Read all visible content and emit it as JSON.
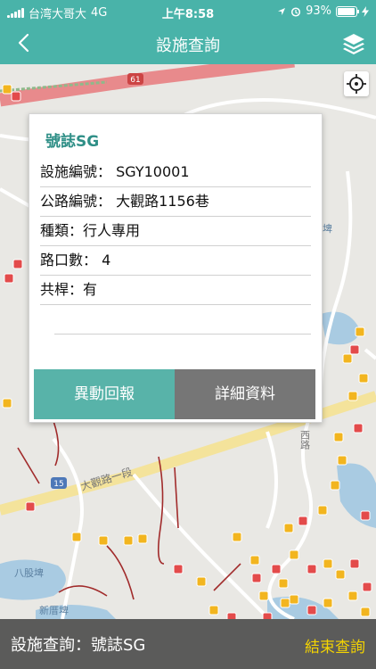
{
  "status_bar": {
    "carrier": "台湾大哥大",
    "network": "4G",
    "time": "上午8:58",
    "battery_percent": "93%",
    "battery_level": 0.93
  },
  "nav": {
    "title": "設施查詢",
    "back_icon": "chevron-left-icon",
    "layers_icon": "layers-icon"
  },
  "map": {
    "road_labels": [
      "61",
      "15",
      "大觀路一段",
      "八股埤",
      "新厝埤",
      "西路",
      "埤"
    ],
    "locate_icon": "crosshair-icon",
    "colors": {
      "land": "#e9e8e4",
      "water": "#a9cbe2",
      "highway": "#e88a8c",
      "major_road": "#f4e39b",
      "minor_road": "#ffffff",
      "poi_yellow": "#f2b51f",
      "poi_red": "#e34b4b",
      "trail": "#a12b2b"
    }
  },
  "card": {
    "title": "號誌SG",
    "rows": [
      "設施編號： SGY10001",
      "公路編號： 大觀路1156巷",
      "種類：行人專用",
      "路口數： 4",
      "共桿：有"
    ],
    "report_button": "異動回報",
    "detail_button": "詳細資料",
    "accent": "#2f8f87"
  },
  "bottom_bar": {
    "status": "設施查詢：號誌SG",
    "end_button": "結束查詢",
    "end_color": "#f5d400"
  },
  "theme": {
    "primary": "#49b3a9"
  }
}
